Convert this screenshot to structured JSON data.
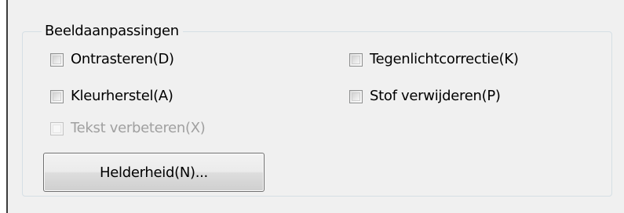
{
  "group": {
    "title": "Beeldaanpassingen"
  },
  "checkboxes": [
    {
      "label": "Ontrasteren(D)",
      "checked": false,
      "enabled": true
    },
    {
      "label": "Tegenlichtcorrectie(K)",
      "checked": false,
      "enabled": true
    },
    {
      "label": "Kleurherstel(A)",
      "checked": false,
      "enabled": true
    },
    {
      "label": "Stof verwijderen(P)",
      "checked": false,
      "enabled": true
    },
    {
      "label": "Tekst verbeteren(X)",
      "checked": false,
      "enabled": false
    }
  ],
  "button": {
    "label": "Helderheid(N)..."
  }
}
